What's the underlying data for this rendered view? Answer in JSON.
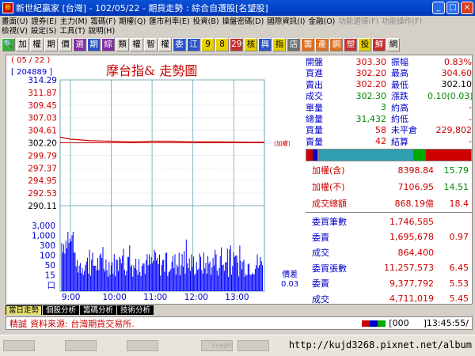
{
  "window": {
    "title": "新世紀贏家 [台灣] - 102/05/22 - 期貨走勢 : 綜合自選股[名望股]",
    "btn_min": "_",
    "btn_max": "□",
    "btn_close": "×"
  },
  "menus": [
    "畫面(U)",
    "證券(E)",
    "主力(M)",
    "籌碼(F)",
    "期權(Q)",
    "匯市利率(E)",
    "投資(B)",
    "操盤密碼(D)",
    "國際資訊(I)",
    "金融(O)",
    "功能選擇(F)",
    "功能操作(F)"
  ],
  "menus2": [
    "檢視(V)",
    "設定(S)",
    "工具(T)",
    "說明(H)"
  ],
  "toolbar": [
    "加",
    "權",
    "期",
    "價",
    "選",
    "期",
    "綜",
    "類",
    "權",
    "智",
    "權",
    "委",
    "江",
    "9",
    "8",
    "29",
    "核",
    "興",
    "指",
    "店",
    "籌",
    "產",
    "鋼",
    "塑",
    "投",
    "鮮",
    "網"
  ],
  "chart": {
    "date": "( 05 / 22 )",
    "code": "[ 204889 ]",
    "title": "摩台指&  走勢圖",
    "change_tag": "(加權)",
    "spread_label": "價差",
    "spread_value": "0.03"
  },
  "chart_data": {
    "type": "line",
    "title": "摩台指&  走勢圖",
    "xlabel": "",
    "ylabel": "",
    "x_ticks": [
      "9:00",
      "10:00",
      "11:00",
      "12:00",
      "13:00"
    ],
    "y_ticks": [
      "314.29",
      "311.87",
      "309.45",
      "307.03",
      "304.61",
      "302.20",
      "299.79",
      "297.37",
      "294.95",
      "292.53",
      "290.11"
    ],
    "ylim": [
      290.11,
      314.29
    ],
    "ref_price": 302.2,
    "volume_ticks": [
      "3,000",
      "1,000",
      "300",
      "100",
      "50",
      "15",
      "口"
    ],
    "price_series": [
      {
        "x": "8:45",
        "y": 303.3
      },
      {
        "x": "9:00",
        "y": 302.9
      },
      {
        "x": "9:30",
        "y": 302.6
      },
      {
        "x": "10:00",
        "y": 302.5
      },
      {
        "x": "10:30",
        "y": 302.4
      },
      {
        "x": "11:00",
        "y": 302.5
      },
      {
        "x": "11:30",
        "y": 302.5
      },
      {
        "x": "12:00",
        "y": 302.4
      },
      {
        "x": "12:30",
        "y": 302.4
      },
      {
        "x": "13:00",
        "y": 302.35
      },
      {
        "x": "13:45",
        "y": 302.3
      }
    ]
  },
  "quote": {
    "rows": [
      {
        "l": "開盤",
        "v": "303.30",
        "l2": "振幅",
        "v2": "0.83%"
      },
      {
        "l": "買進",
        "v": "302.20",
        "l2": "最高",
        "v2": "304.60"
      },
      {
        "l": "賣出",
        "v": "302.20",
        "l2": "最低",
        "v2": "302.10"
      },
      {
        "l": "成交",
        "v": "302.30",
        "l2": "漲跌",
        "v2": "0.10(0.03)"
      },
      {
        "l": "單量",
        "v": "3",
        "l2": "約高",
        "v2": "-"
      },
      {
        "l": "總量",
        "v": "31,432",
        "l2": "約低",
        "v2": "-"
      },
      {
        "l": "買量",
        "v": "58",
        "l2": "未平倉",
        "v2": "229,802"
      },
      {
        "l": "賣量",
        "v": "42",
        "l2": "結算",
        "v2": "-"
      }
    ],
    "index": [
      {
        "l": "加權(含)",
        "v": "8398.84",
        "c": "15.79"
      },
      {
        "l": "加權(不)",
        "v": "7106.95",
        "c": "14.51"
      },
      {
        "l": "成交總額",
        "v": "868.19億",
        "c": "18.4"
      }
    ],
    "orders": [
      {
        "l": "委買筆數",
        "v": "1,746,585",
        "c": ""
      },
      {
        "l": "委賣",
        "v": "1,695,678",
        "c": "0.97"
      },
      {
        "l": "成交",
        "v": "864,400",
        "c": ""
      },
      {
        "l": "委買張數",
        "v": "11,257,573",
        "c": "6.45"
      },
      {
        "l": "委賣",
        "v": "9,377,792",
        "c": "5.53"
      },
      {
        "l": "成交",
        "v": "4,711,019",
        "c": "5.45"
      }
    ]
  },
  "tabs": [
    "當日走勢",
    "個股分析",
    "籌碼分析",
    "技術分析"
  ],
  "status": {
    "label": "精誠",
    "source": "資料來源: 台灣期貨交易所.",
    "count": "[000",
    "time": "]13:45:55/"
  },
  "taskbar": {
    "url": "http://kujd3268.pixnet.net/album",
    "items": [
      "",
      "",
      "",
      "Snagit",
      "",
      ""
    ]
  },
  "colors": {
    "up": "#cc0000",
    "down": "#008800",
    "label": "#0000cc",
    "ref": "#cc0000",
    "volume": "#0000ff"
  }
}
